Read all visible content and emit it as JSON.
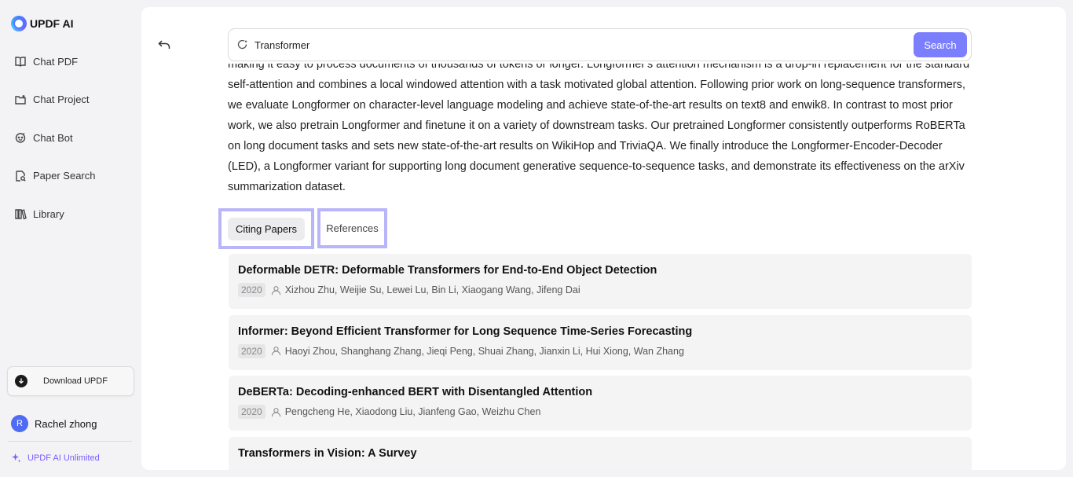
{
  "app": {
    "name": "UPDF AI"
  },
  "sidebar": {
    "items": [
      {
        "label": "Chat PDF",
        "icon": "chat-pdf-icon"
      },
      {
        "label": "Chat Project",
        "icon": "chat-project-icon"
      },
      {
        "label": "Chat Bot",
        "icon": "chat-bot-icon"
      },
      {
        "label": "Paper Search",
        "icon": "paper-search-icon"
      },
      {
        "label": "Library",
        "icon": "library-icon"
      }
    ],
    "download_label": "Download UPDF",
    "user": {
      "initial": "R",
      "name": "Rachel zhong"
    },
    "plan_label": "UPDF AI Unlimited"
  },
  "search": {
    "value": "Transformer",
    "button_label": "Search"
  },
  "abstract": {
    "text": "making it easy to process documents of thousands of tokens or longer. Longformer's attention mechanism is a drop-in replacement for the standard self-attention and combines a local windowed attention with a task motivated global attention. Following prior work on long-sequence transformers, we evaluate Longformer on character-level language modeling and achieve state-of-the-art results on text8 and enwik8. In contrast to most prior work, we also pretrain Longformer and finetune it on a variety of downstream tasks. Our pretrained Longformer consistently outperforms RoBERTa on long document tasks and sets new state-of-the-art results on WikiHop and TriviaQA. We finally introduce the Longformer-Encoder-Decoder (LED), a Longformer variant for supporting long document generative sequence-to-sequence tasks, and demonstrate its effectiveness on the arXiv summarization dataset."
  },
  "tabs": {
    "citing": "Citing Papers",
    "references": "References"
  },
  "papers": [
    {
      "title": "Deformable DETR: Deformable Transformers for End-to-End Object Detection",
      "year": "2020",
      "authors": "Xizhou Zhu, Weijie Su, Lewei Lu, Bin Li, Xiaogang Wang, Jifeng Dai"
    },
    {
      "title": "Informer: Beyond Efficient Transformer for Long Sequence Time-Series Forecasting",
      "year": "2020",
      "authors": "Haoyi Zhou, Shanghang Zhang, Jieqi Peng, Shuai Zhang, Jianxin Li, Hui Xiong, Wan Zhang"
    },
    {
      "title": "DeBERTa: Decoding-enhanced BERT with Disentangled Attention",
      "year": "2020",
      "authors": "Pengcheng He, Xiaodong Liu, Jianfeng Gao, Weizhu Chen"
    },
    {
      "title": "Transformers in Vision: A Survey",
      "year": "",
      "authors": ""
    }
  ],
  "colors": {
    "accent": "#7b7ffd",
    "highlight": "#b8b6f8",
    "plan": "#7b5cff",
    "avatar": "#4e6bf2"
  }
}
